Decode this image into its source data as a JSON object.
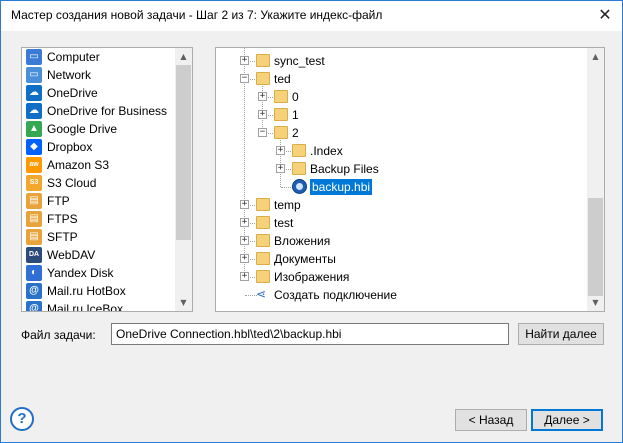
{
  "window": {
    "title": "Мастер создания новой задачи - Шаг 2 из 7: Укажите индекс-файл",
    "close_glyph": "✕"
  },
  "storages": [
    {
      "label": "Computer",
      "icon": "computer-icon",
      "color": "#3a7bd5",
      "glyph": "▭"
    },
    {
      "label": "Network",
      "icon": "network-icon",
      "color": "#4a90d9",
      "glyph": "▭"
    },
    {
      "label": "OneDrive",
      "icon": "onedrive-icon",
      "color": "#0f6fc6",
      "glyph": "☁"
    },
    {
      "label": "OneDrive for Business",
      "icon": "onedrive-business-icon",
      "color": "#0f6fc6",
      "glyph": "☁"
    },
    {
      "label": "Google Drive",
      "icon": "google-drive-icon",
      "color": "#34a853",
      "glyph": "▲"
    },
    {
      "label": "Dropbox",
      "icon": "dropbox-icon",
      "color": "#0061fe",
      "glyph": "◆"
    },
    {
      "label": "Amazon S3",
      "icon": "amazon-s3-icon",
      "color": "#ff9900",
      "glyph": "aws"
    },
    {
      "label": "S3 Cloud",
      "icon": "s3-cloud-icon",
      "color": "#f3a72c",
      "glyph": "S3"
    },
    {
      "label": "FTP",
      "icon": "ftp-icon",
      "color": "#e8a33b",
      "glyph": "▤"
    },
    {
      "label": "FTPS",
      "icon": "ftps-icon",
      "color": "#e8a33b",
      "glyph": "▤"
    },
    {
      "label": "SFTP",
      "icon": "sftp-icon",
      "color": "#e8a33b",
      "glyph": "▤"
    },
    {
      "label": "WebDAV",
      "icon": "webdav-icon",
      "color": "#2c4a7a",
      "glyph": "DAV"
    },
    {
      "label": "Yandex Disk",
      "icon": "yandex-disk-icon",
      "color": "#2f6fd6",
      "glyph": "◐"
    },
    {
      "label": "Mail.ru HotBox",
      "icon": "mailru-hotbox-icon",
      "color": "#2a73c9",
      "glyph": "@"
    },
    {
      "label": "Mail.ru IceBox",
      "icon": "mailru-icebox-icon",
      "color": "#2a73c9",
      "glyph": "@"
    }
  ],
  "tree": [
    {
      "label": "sync_test",
      "type": "folder",
      "level": 1,
      "expander": "+"
    },
    {
      "label": "ted",
      "type": "folder",
      "level": 1,
      "expander": "−"
    },
    {
      "label": "0",
      "type": "folder",
      "level": 2,
      "expander": "+"
    },
    {
      "label": "1",
      "type": "folder",
      "level": 2,
      "expander": "+"
    },
    {
      "label": "2",
      "type": "folder",
      "level": 2,
      "expander": "−"
    },
    {
      "label": ".Index",
      "type": "folder",
      "level": 3,
      "expander": "+"
    },
    {
      "label": "Backup Files",
      "type": "folder",
      "level": 3,
      "expander": "+"
    },
    {
      "label": "backup.hbi",
      "type": "file",
      "level": 3,
      "expander": "",
      "selected": true
    },
    {
      "label": "temp",
      "type": "folder",
      "level": 1,
      "expander": "+"
    },
    {
      "label": "test",
      "type": "folder",
      "level": 1,
      "expander": "+"
    },
    {
      "label": "Вложения",
      "type": "folder",
      "level": 1,
      "expander": "+"
    },
    {
      "label": "Документы",
      "type": "folder",
      "level": 1,
      "expander": "+"
    },
    {
      "label": "Изображения",
      "type": "folder",
      "level": 1,
      "expander": "+"
    },
    {
      "label": "Создать подключение",
      "type": "action",
      "level": 0,
      "expander": ""
    }
  ],
  "task_file": {
    "label": "Файл задачи:",
    "value": "OneDrive Connection.hbl\\ted\\2\\backup.hbi"
  },
  "buttons": {
    "find_next": "Найти далее",
    "back": "< Назад",
    "next": "Далее >",
    "help": "?"
  },
  "colors": {
    "selection": "#0078d7",
    "folder": "#f5d27a",
    "accent": "#1f6fc4"
  }
}
